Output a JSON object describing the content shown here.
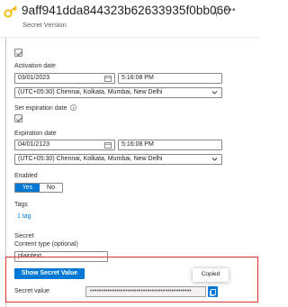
{
  "header": {
    "title": "9aff941dda844323b62633935f0bb060",
    "subtitle": "Secret Version"
  },
  "activation": {
    "label": "Activation date",
    "date": "03/01/2023",
    "time": "5:16:08 PM",
    "timezone": "(UTC+05:30) Chennai, Kolkata, Mumbai, New Delhi"
  },
  "expiration": {
    "checkbox_label": "Set expiration date",
    "label": "Expiration date",
    "date": "04/01/2123",
    "time": "5:16:08 PM",
    "timezone": "(UTC+05:30) Chennai, Kolkata, Mumbai, New Delhi"
  },
  "enabled": {
    "label": "Enabled",
    "yes": "Yes",
    "no": "No",
    "selected": "Yes"
  },
  "tags": {
    "label": "Tags",
    "link": "1 tag"
  },
  "secret": {
    "heading": "Secret",
    "content_type_label": "Content type (optional)",
    "content_type_value": "plaintext",
    "show_button": "Show Secret Value",
    "value_label": "Secret value",
    "masked_value": "••••••••••••••••••••••••••••••••••••••••••••••",
    "copied_tooltip": "Copied"
  },
  "colors": {
    "accent": "#0078d4",
    "highlight": "#e03131"
  }
}
